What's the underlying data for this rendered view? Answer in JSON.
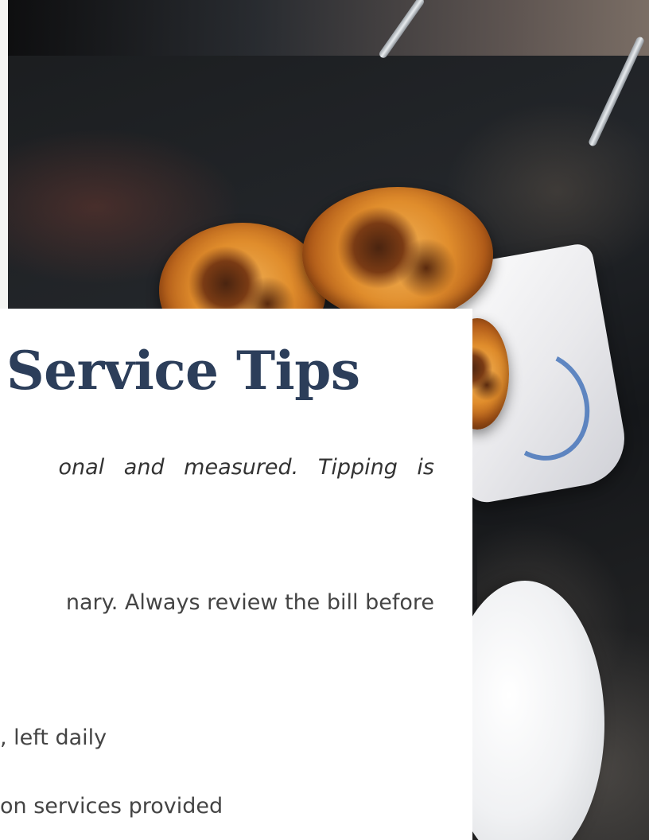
{
  "document": {
    "title": "Service Tips",
    "intro_fragment": "onal and measured. Tipping is",
    "paragraph_fragment": "nary. Always review the bill before",
    "list_items": [
      ", left daily",
      "on services provided"
    ]
  },
  "image": {
    "subject": "Portuguese custard tarts in a paper-lined bowl on a dark table",
    "colors": {
      "title": "#2c3e5a",
      "body_text": "#444444",
      "card_background": "#ffffff"
    }
  }
}
